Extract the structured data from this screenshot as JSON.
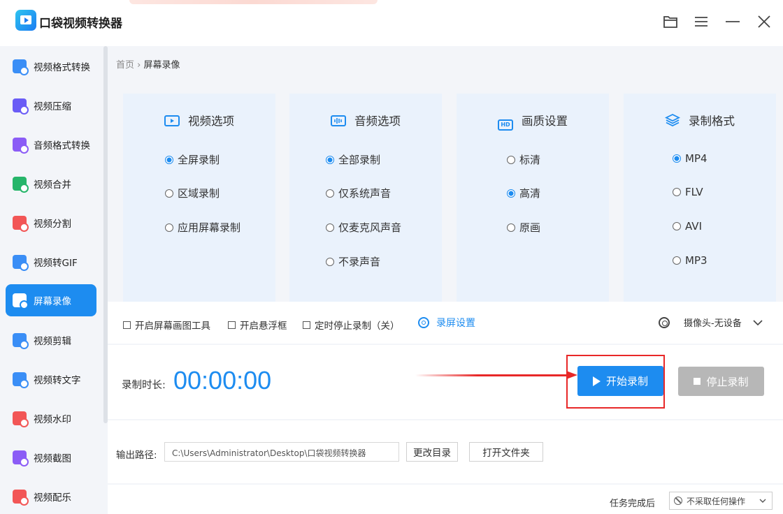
{
  "app": {
    "title": "口袋视频转换器"
  },
  "sidebar": {
    "items": [
      {
        "label": "视频格式转换",
        "color": "#3a8ef6",
        "active": false
      },
      {
        "label": "视频压缩",
        "color": "#6a5cf6",
        "active": false
      },
      {
        "label": "音频格式转换",
        "color": "#8b5cf6",
        "active": false
      },
      {
        "label": "视频合并",
        "color": "#26b56a",
        "active": false
      },
      {
        "label": "视频分割",
        "color": "#f25656",
        "active": false
      },
      {
        "label": "视频转GIF",
        "color": "#3a8ef6",
        "active": false
      },
      {
        "label": "屏幕录像",
        "color": "#ffffff",
        "active": true
      },
      {
        "label": "视频剪辑",
        "color": "#3a8ef6",
        "active": false
      },
      {
        "label": "视频转文字",
        "color": "#3a8ef6",
        "active": false
      },
      {
        "label": "视频水印",
        "color": "#f25656",
        "active": false
      },
      {
        "label": "视频截图",
        "color": "#8b5cf6",
        "active": false
      },
      {
        "label": "视频配乐",
        "color": "#f25656",
        "active": false
      }
    ]
  },
  "breadcrumb": {
    "home": "首页",
    "sep": "›",
    "current": "屏幕录像"
  },
  "options": {
    "video": {
      "title": "视频选项",
      "icon": "video-screen-icon",
      "items": [
        "全屏录制",
        "区域录制",
        "应用屏幕录制"
      ],
      "selected": 0
    },
    "audio": {
      "title": "音频选项",
      "icon": "audio-wave-icon",
      "items": [
        "全部录制",
        "仅系统声音",
        "仅麦克风声音",
        "不录声音"
      ],
      "selected": 0
    },
    "quality": {
      "title": "画质设置",
      "icon": "hd-icon",
      "items": [
        "标清",
        "高清",
        "原画"
      ],
      "selected": 1
    },
    "format": {
      "title": "录制格式",
      "icon": "layers-icon",
      "items": [
        "MP4",
        "FLV",
        "AVI",
        "MP3"
      ],
      "selected": 0
    }
  },
  "toolbar": {
    "draw_tool": "开启屏幕画图工具",
    "float_box": "开启悬浮框",
    "timer_stop": "定时停止录制（关）",
    "settings": "录屏设置",
    "camera": "摄像头-无设备"
  },
  "record": {
    "duration_label": "录制时长:",
    "duration": "00:00:00",
    "start": "开始录制",
    "stop": "停止录制"
  },
  "output": {
    "label": "输出路径:",
    "path": "C:\\Users\\Administrator\\Desktop\\口袋视频转换器",
    "change_dir": "更改目录",
    "open_folder": "打开文件夹"
  },
  "footer": {
    "after_label": "任务完成后",
    "after_value": "不采取任何操作"
  },
  "colors": {
    "accent": "#1d8cf0",
    "highlight": "#e82828",
    "card_bg": "#eaf2fc",
    "stop_bg": "#b7b7b7"
  }
}
